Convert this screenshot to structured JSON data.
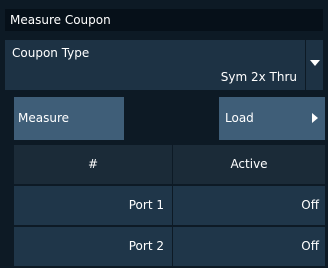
{
  "panel": {
    "title": "Measure Coupon"
  },
  "coupon_type": {
    "label": "Coupon Type",
    "value": "Sym 2x Thru"
  },
  "buttons": {
    "measure_label": "Measure",
    "load_label": "Load"
  },
  "table": {
    "headers": [
      "#",
      "Active"
    ],
    "rows": [
      {
        "port": "Port 1",
        "active": "Off"
      },
      {
        "port": "Port 2",
        "active": "Off"
      }
    ]
  },
  "colors": {
    "background": "#0d1a25",
    "button": "#3f5e78",
    "field": "#1d3244"
  }
}
